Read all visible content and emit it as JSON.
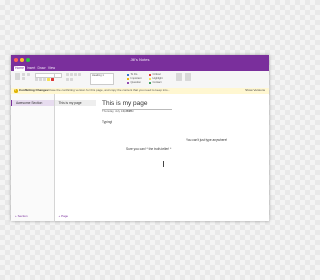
{
  "window": {
    "title": "Jill's Notes"
  },
  "ribbon": {
    "tabs": [
      "Home",
      "Insert",
      "Draw",
      "View"
    ],
    "active_tab": "Home",
    "heading_style": "Heading 1",
    "tags": [
      {
        "label": "To Do",
        "color": "#2e6fd1"
      },
      {
        "label": "Important",
        "color": "#f0b400"
      },
      {
        "label": "Question",
        "color": "#8e44ad"
      },
      {
        "label": "Critical",
        "color": "#d33"
      },
      {
        "label": "Highlight",
        "color": "#f4e04d"
      },
      {
        "label": "Contact",
        "color": "#3a9b5a"
      }
    ]
  },
  "notification": {
    "title": "Conflicting Changes",
    "message": "Close the conflicting version for this page, and copy the content that you need to keep into...",
    "action": "Show Versions"
  },
  "sidebar": {
    "section": "Awesome Section",
    "add_section": "+ Section"
  },
  "pages": {
    "item": "This is my page",
    "add_page": "+ Page"
  },
  "page": {
    "title": "This is my page",
    "date": "Thursday, July 14, 2016",
    "time": "4:28 PM",
    "body": {
      "line1": "Typing!",
      "line2": "You can't just type anywhere!",
      "line3": "Sure you can! * the truth-teller! *"
    }
  },
  "colors": {
    "accent": "#7a2f9c",
    "notice_background": "#fff7d1"
  }
}
